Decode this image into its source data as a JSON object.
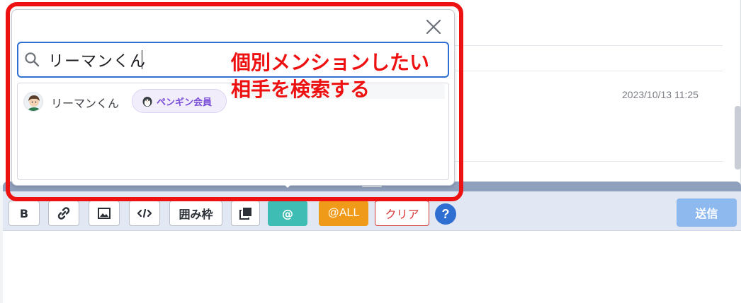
{
  "message": {
    "timestamp": "2023/10/13 11:25"
  },
  "popup": {
    "close_icon": "close-icon",
    "search": {
      "icon": "search-icon",
      "value": "リーマンくん"
    },
    "results": [
      {
        "name": "リーマンくん",
        "badge": "ペンギン会員",
        "badge_icon": "penguin-icon",
        "avatar": "avatar"
      }
    ]
  },
  "annotation": {
    "line1": "個別メンションしたい",
    "line2": "相手を検索する",
    "color": "#ee1111"
  },
  "toolbar": {
    "bold_label": "B",
    "link_icon": "link-icon",
    "image_icon": "image-icon",
    "code_icon": "code-icon",
    "frame_label": "囲み枠",
    "copy_icon": "copy-icon",
    "mention_label": "@",
    "all_label": "@ALL",
    "clear_label": "クリア",
    "help_label": "?",
    "send_label": "送信"
  },
  "colors": {
    "accent_blue": "#2f6fd1",
    "mention_teal": "#3dbdb4",
    "all_orange": "#ef9a18",
    "clear_red": "#d63838",
    "send_disabled": "#8eb9ef"
  }
}
